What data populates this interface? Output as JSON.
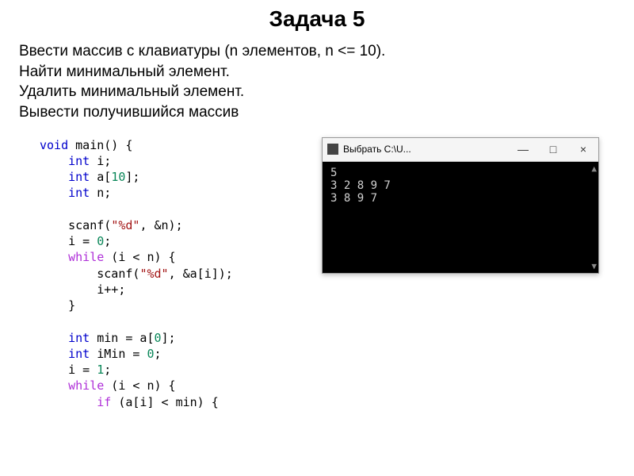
{
  "heading": "Задача 5",
  "description": {
    "l1": "Ввести массив с клавиатуры (n элементов, n <= 10).",
    "l2": "Найти минимальный элемент.",
    "l3": "Удалить минимальный элемент.",
    "l4": "Вывести получившийся массив"
  },
  "code": {
    "kw_void": "void",
    "fn_main_sig": " main() {",
    "kw_int": "int",
    "var_i": " i;",
    "arr_decl_name": " a[",
    "arr_size": "10",
    "arr_close": "];",
    "var_n": " n;",
    "scanf1_a": "scanf(",
    "fmt": "\"%d\"",
    "scanf1_b": ", &n);",
    "assign_i0_a": "i = ",
    "zero": "0",
    "semi": ";",
    "kw_while": "while",
    "while_cond": " (i < n) {",
    "scanf2_b": ", &a[i]);",
    "ipp": "i++;",
    "rbrace": "}",
    "min_decl": " min = a[",
    "min_idx": "0",
    "rsq_semi": "];",
    "imin_decl": " iMin = ",
    "one": "1",
    "kw_if": "if",
    "if_cond": " (a[i] < min) {"
  },
  "console": {
    "title": "Выбрать C:\\U...",
    "buttons": {
      "min": "—",
      "max": "□",
      "close": "×"
    },
    "lines": {
      "l1": "5",
      "l2": "3 2 8 9 7",
      "l3": "3 8 9 7"
    }
  }
}
